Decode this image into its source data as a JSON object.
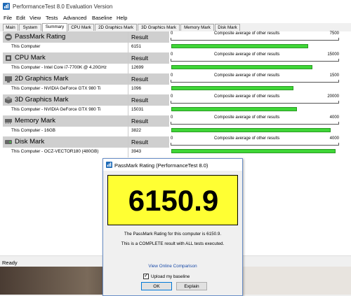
{
  "window": {
    "title": "PerformanceTest 8.0 Evaluation Version",
    "icon": "performancetest-app-icon"
  },
  "menu": [
    "File",
    "Edit",
    "View",
    "Tests",
    "Advanced",
    "Baseline",
    "Help"
  ],
  "tabs": [
    {
      "label": "Main",
      "active": false
    },
    {
      "label": "System",
      "active": false
    },
    {
      "label": "Summary",
      "active": true
    },
    {
      "label": "CPU Mark",
      "active": false
    },
    {
      "label": "2D Graphics Mark",
      "active": false
    },
    {
      "label": "3D Graphics Mark",
      "active": false
    },
    {
      "label": "Memory Mark",
      "active": false
    },
    {
      "label": "Disk Mark",
      "active": false
    }
  ],
  "sections": [
    {
      "title": "PassMark Rating",
      "result_label": "Result",
      "row_label": "This Computer",
      "value": "6151",
      "scale_min": "0",
      "scale_caption": "Composite average of other results",
      "scale_max": "7500",
      "fraction": 0.82,
      "icon": "passmark-rating-icon"
    },
    {
      "title": "CPU Mark",
      "result_label": "Result",
      "row_label": "This Computer - Intel Core i7-7700K @ 4.20GHz",
      "value": "12699",
      "scale_min": "0",
      "scale_caption": "Composite average of other results",
      "scale_max": "15000",
      "fraction": 0.846,
      "icon": "cpu-mark-icon"
    },
    {
      "title": "2D Graphics Mark",
      "result_label": "Result",
      "row_label": "This Computer - NVIDIA GeForce GTX 980 Ti",
      "value": "1096",
      "scale_min": "0",
      "scale_caption": "Composite average of other results",
      "scale_max": "1500",
      "fraction": 0.73,
      "icon": "2d-graphics-icon"
    },
    {
      "title": "3D Graphics Mark",
      "result_label": "Result",
      "row_label": "This Computer - NVIDIA GeForce GTX 980 Ti",
      "value": "15031",
      "scale_min": "0",
      "scale_caption": "Composite average of other results",
      "scale_max": "20000",
      "fraction": 0.75,
      "icon": "3d-graphics-icon"
    },
    {
      "title": "Memory Mark",
      "result_label": "Result",
      "row_label": "This Computer - 16GB",
      "value": "3822",
      "scale_min": "0",
      "scale_caption": "Composite average of other results",
      "scale_max": "4000",
      "fraction": 0.955,
      "icon": "memory-mark-icon"
    },
    {
      "title": "Disk Mark",
      "result_label": "Result",
      "row_label": "This Computer - OCZ-VECTOR180 (480GB)",
      "value": "3943",
      "scale_min": "0",
      "scale_caption": "Composite average of other results",
      "scale_max": "4000",
      "fraction": 0.985,
      "icon": "disk-mark-icon"
    }
  ],
  "status": "Ready",
  "dialog": {
    "title": "PassMark Rating (PerformanceTest 8.0)",
    "score": "6150.9",
    "line1": "The PassMark Rating for this computer is 6150.9.",
    "line2": "This is a COMPLETE result with ALL tests executed.",
    "link": "View Online Comparison",
    "checkbox_label": "Upload my baseline",
    "checkbox_checked": true,
    "ok": "OK",
    "explain": "Explain"
  },
  "colors": {
    "bar": "#3fd637",
    "score_bg": "#ffff33",
    "header_bg": "#cfcfcf"
  }
}
